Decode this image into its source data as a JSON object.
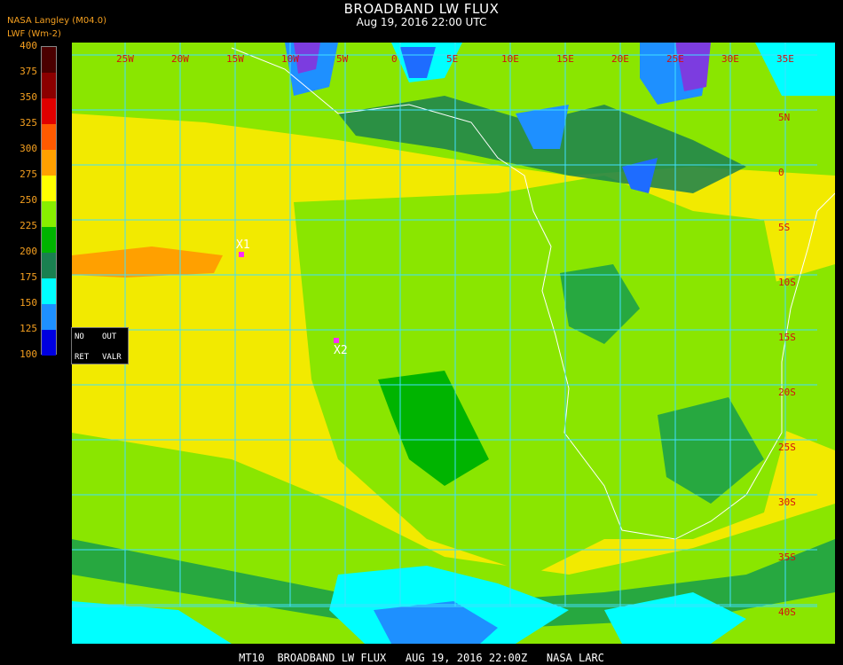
{
  "header": {
    "title": "BROADBAND LW FLUX",
    "subtitle": "Aug 19, 2016 22:00 UTC",
    "source": "NASA Langley (M04.0)",
    "units": "LWF (Wm-2)"
  },
  "colorbar": {
    "ticks": [
      "400",
      "375",
      "350",
      "325",
      "300",
      "275",
      "250",
      "225",
      "200",
      "175",
      "150",
      "125",
      "100"
    ],
    "colors": [
      "#4a0000",
      "#8b0000",
      "#e00000",
      "#ff5a00",
      "#ffa000",
      "#ffff00",
      "#88ee00",
      "#00b400",
      "#1a8050",
      "#00ffff",
      "#1e90ff",
      "#0000e0",
      "#9a40e0"
    ]
  },
  "map": {
    "longitude_labels": [
      "25W",
      "20W",
      "15W",
      "10W",
      "5W",
      "0",
      "5E",
      "10E",
      "15E",
      "20E",
      "25E",
      "30E",
      "35E"
    ],
    "latitude_labels": [
      "5N",
      "0",
      "5S",
      "10S",
      "15S",
      "20S",
      "25S",
      "30S",
      "35S",
      "40S"
    ],
    "grid_color": "#40e0ff"
  },
  "markers": [
    {
      "label": "X1"
    },
    {
      "label": "X2"
    }
  ],
  "panel": {
    "no": "NO",
    "out": "OUT",
    "ret": "RET",
    "valr": "VALR"
  },
  "footer": "MT10  BROADBAND LW FLUX   AUG 19, 2016 22:00Z   NASA LARC"
}
